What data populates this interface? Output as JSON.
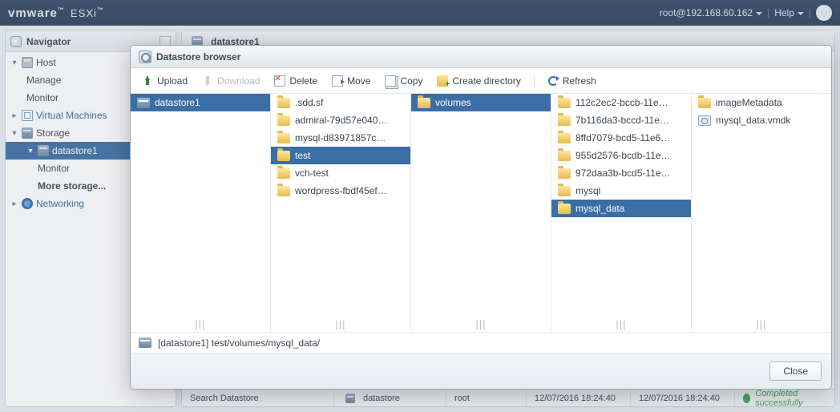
{
  "brand": {
    "name": "vmware",
    "product": "ESXi",
    "tm": "™"
  },
  "topbar": {
    "user": "root@192.168.60.162",
    "help": "Help"
  },
  "navigator": {
    "title": "Navigator",
    "host": "Host",
    "manage": "Manage",
    "monitor": "Monitor",
    "virtual_machines": "Virtual Machines",
    "storage": "Storage",
    "datastore1": "datastore1",
    "ds_monitor": "Monitor",
    "more_storage": "More storage...",
    "networking": "Networking"
  },
  "content": {
    "title": "datastore1"
  },
  "task_row": {
    "task": "Search Datastore",
    "target": "datastore",
    "user": "root",
    "queued": "12/07/2016 18:24:40",
    "started": "12/07/2016 18:24:40",
    "status": "Completed successfully"
  },
  "modal": {
    "title": "Datastore browser",
    "toolbar": {
      "upload": "Upload",
      "download": "Download",
      "delete": "Delete",
      "move": "Move",
      "copy": "Copy",
      "create_dir": "Create directory",
      "refresh": "Refresh"
    },
    "columns": [
      {
        "items": [
          {
            "icon": "ds",
            "label": "datastore1",
            "selected": true
          }
        ]
      },
      {
        "items": [
          {
            "icon": "folder",
            "label": ".sdd.sf"
          },
          {
            "icon": "folder",
            "label": "admiral-79d57e040…"
          },
          {
            "icon": "folder",
            "label": "mysql-d83971857c…"
          },
          {
            "icon": "folder",
            "label": "test",
            "selected": true
          },
          {
            "icon": "folder",
            "label": "vch-test"
          },
          {
            "icon": "folder",
            "label": "wordpress-fbdf45ef…"
          }
        ]
      },
      {
        "items": [
          {
            "icon": "folder",
            "label": "volumes",
            "selected": true
          }
        ]
      },
      {
        "items": [
          {
            "icon": "folder",
            "label": "112c2ec2-bccb-11e…"
          },
          {
            "icon": "folder",
            "label": "7b116da3-bccd-11e…"
          },
          {
            "icon": "folder",
            "label": "8ffd7079-bcd5-11e6…"
          },
          {
            "icon": "folder",
            "label": "955d2576-bcdb-11e…"
          },
          {
            "icon": "folder",
            "label": "972daa3b-bcd5-11e…"
          },
          {
            "icon": "folder",
            "label": "mysql"
          },
          {
            "icon": "folder",
            "label": "mysql_data",
            "selected": true
          }
        ]
      },
      {
        "items": [
          {
            "icon": "folder",
            "label": "imageMetadata"
          },
          {
            "icon": "disk",
            "label": "mysql_data.vmdk"
          }
        ]
      }
    ],
    "path": "[datastore1] test/volumes/mysql_data/",
    "close": "Close"
  }
}
